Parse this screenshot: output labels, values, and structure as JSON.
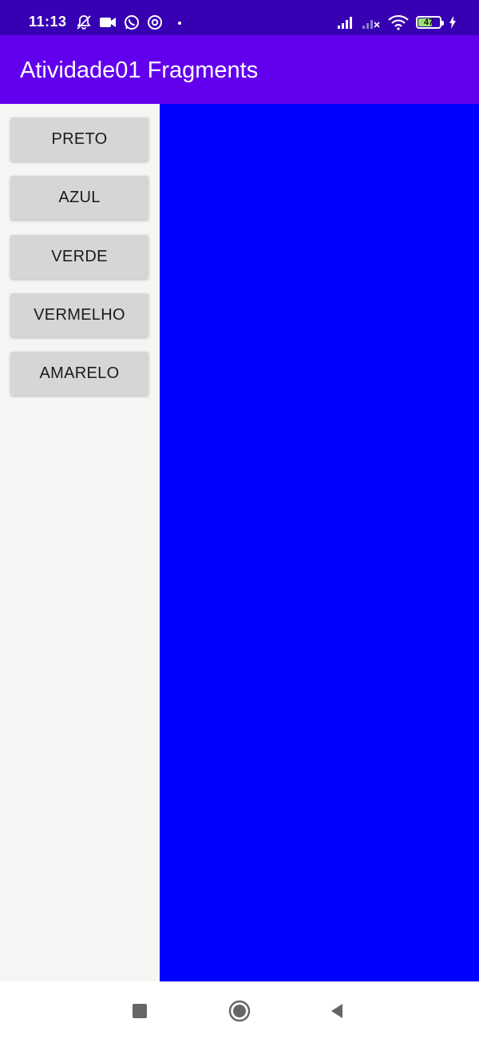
{
  "status_bar": {
    "time": "11:13",
    "battery_level": "47",
    "left_icons": [
      "notifications-off-icon",
      "video-camera-icon",
      "whatsapp-icon",
      "at-sign-icon",
      "dot-icon"
    ],
    "right_icons": [
      "signal-icon",
      "signal-no-service-icon",
      "wifi-icon",
      "battery-icon",
      "charging-icon"
    ]
  },
  "app_bar": {
    "title": "Atividade01 Fragments",
    "color": "#6200ee"
  },
  "buttons": [
    {
      "label": "PRETO"
    },
    {
      "label": "AZUL"
    },
    {
      "label": "VERDE"
    },
    {
      "label": "VERMELHO"
    },
    {
      "label": "AMARELO"
    }
  ],
  "display": {
    "color": "#0000ff"
  },
  "nav_bar": {
    "icons": [
      "square-recents-icon",
      "circle-home-icon",
      "triangle-back-icon"
    ]
  }
}
